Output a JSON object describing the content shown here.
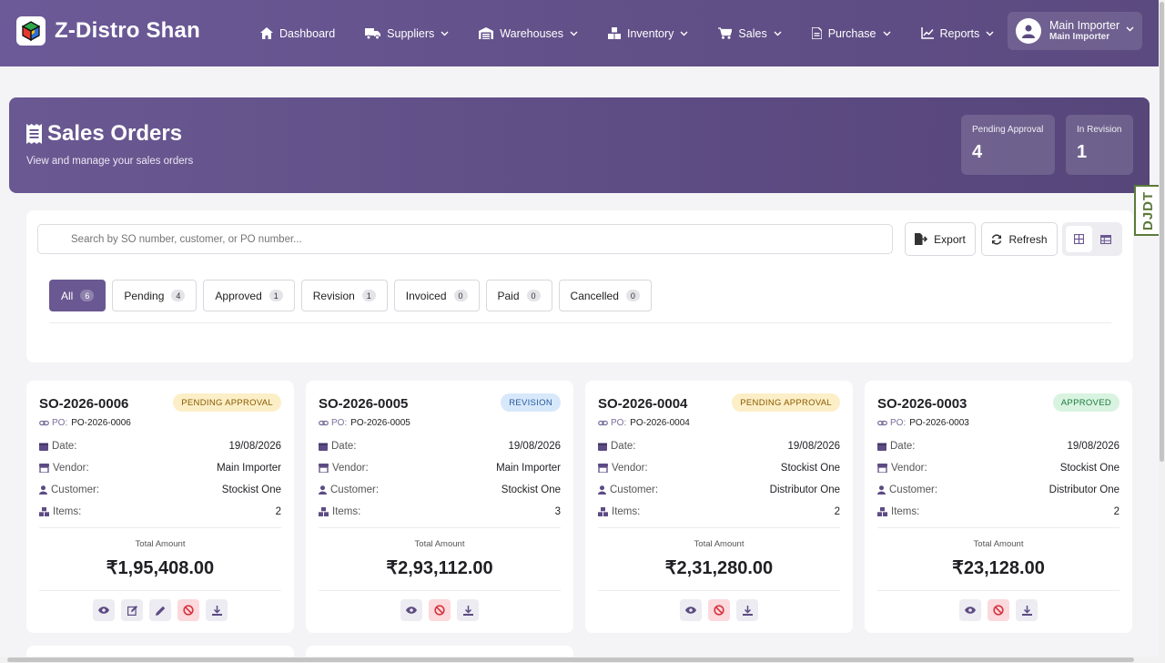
{
  "app": {
    "name": "Z-Distro Shan"
  },
  "nav": {
    "dashboard": "Dashboard",
    "suppliers": "Suppliers",
    "warehouses": "Warehouses",
    "inventory": "Inventory",
    "sales": "Sales",
    "purchase": "Purchase",
    "reports": "Reports"
  },
  "user": {
    "name": "Main Importer",
    "role": "Main Importer"
  },
  "hero": {
    "title": "Sales Orders",
    "subtitle": "View and manage your sales orders",
    "stats": [
      {
        "label": "Pending Approval",
        "value": "4"
      },
      {
        "label": "In Revision",
        "value": "1"
      }
    ]
  },
  "debug_tab": "DJDT",
  "search": {
    "placeholder": "Search by SO number, customer, or PO number..."
  },
  "toolbar": {
    "export": "Export",
    "refresh": "Refresh"
  },
  "tabs": [
    {
      "label": "All",
      "count": "6"
    },
    {
      "label": "Pending",
      "count": "4"
    },
    {
      "label": "Approved",
      "count": "1"
    },
    {
      "label": "Revision",
      "count": "1"
    },
    {
      "label": "Invoiced",
      "count": "0"
    },
    {
      "label": "Paid",
      "count": "0"
    },
    {
      "label": "Cancelled",
      "count": "0"
    }
  ],
  "labels": {
    "po": "PO:",
    "date": "Date:",
    "vendor": "Vendor:",
    "customer": "Customer:",
    "items": "Items:",
    "total": "Total Amount"
  },
  "orders": [
    {
      "so": "SO-2026-0006",
      "status": "PENDING APPROVAL",
      "po": "PO-2026-0006",
      "date": "19/08/2026",
      "vendor": "Main Importer",
      "customer": "Stockist One",
      "items": "2",
      "total": "₹1,95,408.00"
    },
    {
      "so": "SO-2026-0005",
      "status": "REVISION",
      "po": "PO-2026-0005",
      "date": "19/08/2026",
      "vendor": "Main Importer",
      "customer": "Stockist One",
      "items": "3",
      "total": "₹2,93,112.00"
    },
    {
      "so": "SO-2026-0004",
      "status": "PENDING APPROVAL",
      "po": "PO-2026-0004",
      "date": "19/08/2026",
      "vendor": "Stockist One",
      "customer": "Distributor One",
      "items": "2",
      "total": "₹2,31,280.00"
    },
    {
      "so": "SO-2026-0003",
      "status": "APPROVED",
      "po": "PO-2026-0003",
      "date": "19/08/2026",
      "vendor": "Stockist One",
      "customer": "Distributor One",
      "items": "2",
      "total": "₹23,128.00"
    }
  ],
  "colors": {
    "primary": "#6a5892",
    "pending": "#fcefc7",
    "revision": "#d8e8fb",
    "approved": "#d8f3e0",
    "danger": "#fbd9dc"
  }
}
